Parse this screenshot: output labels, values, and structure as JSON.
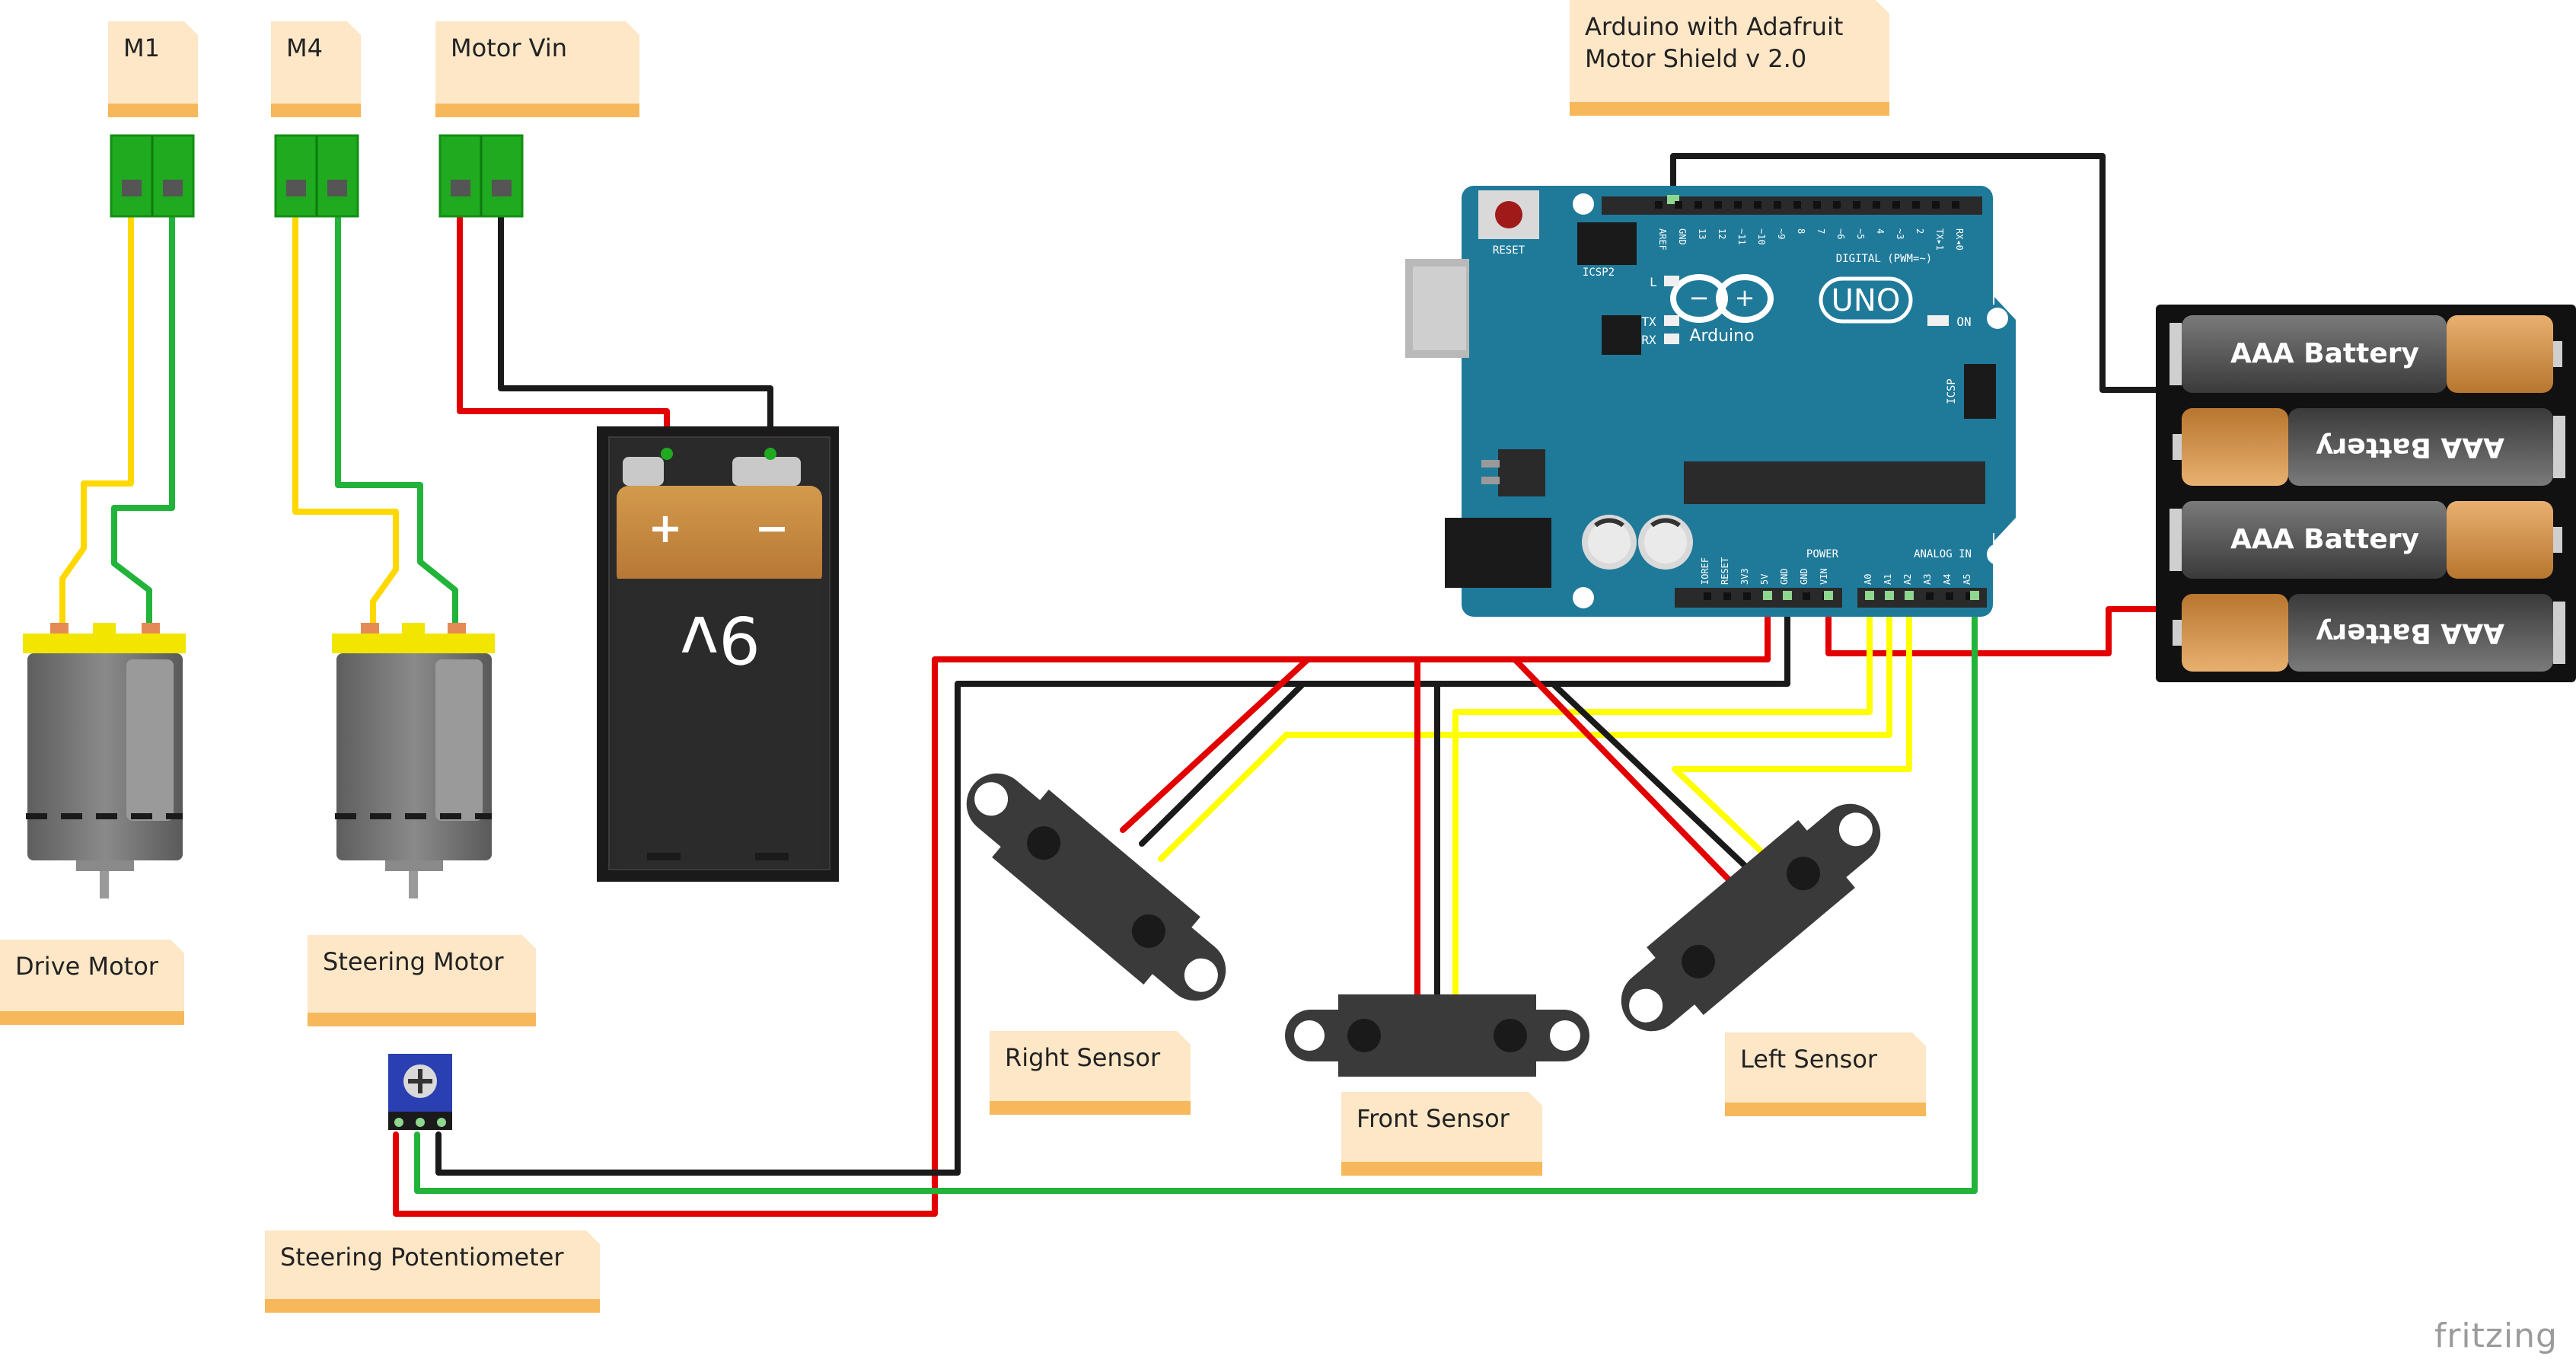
{
  "labels": {
    "m1": "M1",
    "m4": "M4",
    "motor_vin": "Motor Vin",
    "arduino": "Arduino with Adafruit\nMotor Shield v 2.0",
    "drive_motor": "Drive Motor",
    "steering_motor": "Steering Motor",
    "steering_pot": "Steering Potentiometer",
    "right_sensor": "Right Sensor",
    "front_sensor": "Front Sensor",
    "left_sensor": "Left Sensor"
  },
  "battery9v": {
    "text": "9v",
    "plus": "+",
    "minus": "−"
  },
  "aaa_pack": {
    "cell_label": "AAA Battery"
  },
  "arduino_board": {
    "reset": "RESET",
    "icsp2": "ICSP2",
    "icsp": "ICSP",
    "digital": "DIGITAL (PWM=~)",
    "brand": "Arduino",
    "model": "UNO",
    "on": "ON",
    "l": "L",
    "tx": "TX",
    "rx": "RX",
    "power": "POWER",
    "analog": "ANALOG IN",
    "top_pins": [
      "AREF",
      "GND",
      "13",
      "12",
      "~11",
      "~10",
      "~9",
      "8",
      "7",
      "~6",
      "~5",
      "4",
      "~3",
      "2",
      "TX▸1",
      "RX◂0"
    ],
    "power_pins": [
      "IOREF",
      "RESET",
      "3V3",
      "5V",
      "GND",
      "GND",
      "VIN"
    ],
    "analog_pins": [
      "A0",
      "A1",
      "A2",
      "A3",
      "A4",
      "A5"
    ]
  },
  "footer": {
    "brand": "fritzing"
  },
  "colors": {
    "wire_red": "#e20000",
    "wire_black": "#1a1a1a",
    "wire_yellow": "#ffd800",
    "wire_green": "#22b33a",
    "wire_bright_yellow": "#ffff00",
    "board": "#1f7a9a",
    "terminal": "#1faa1f",
    "note_bg": "#fde7c7",
    "note_stripe": "#f6b85a"
  }
}
